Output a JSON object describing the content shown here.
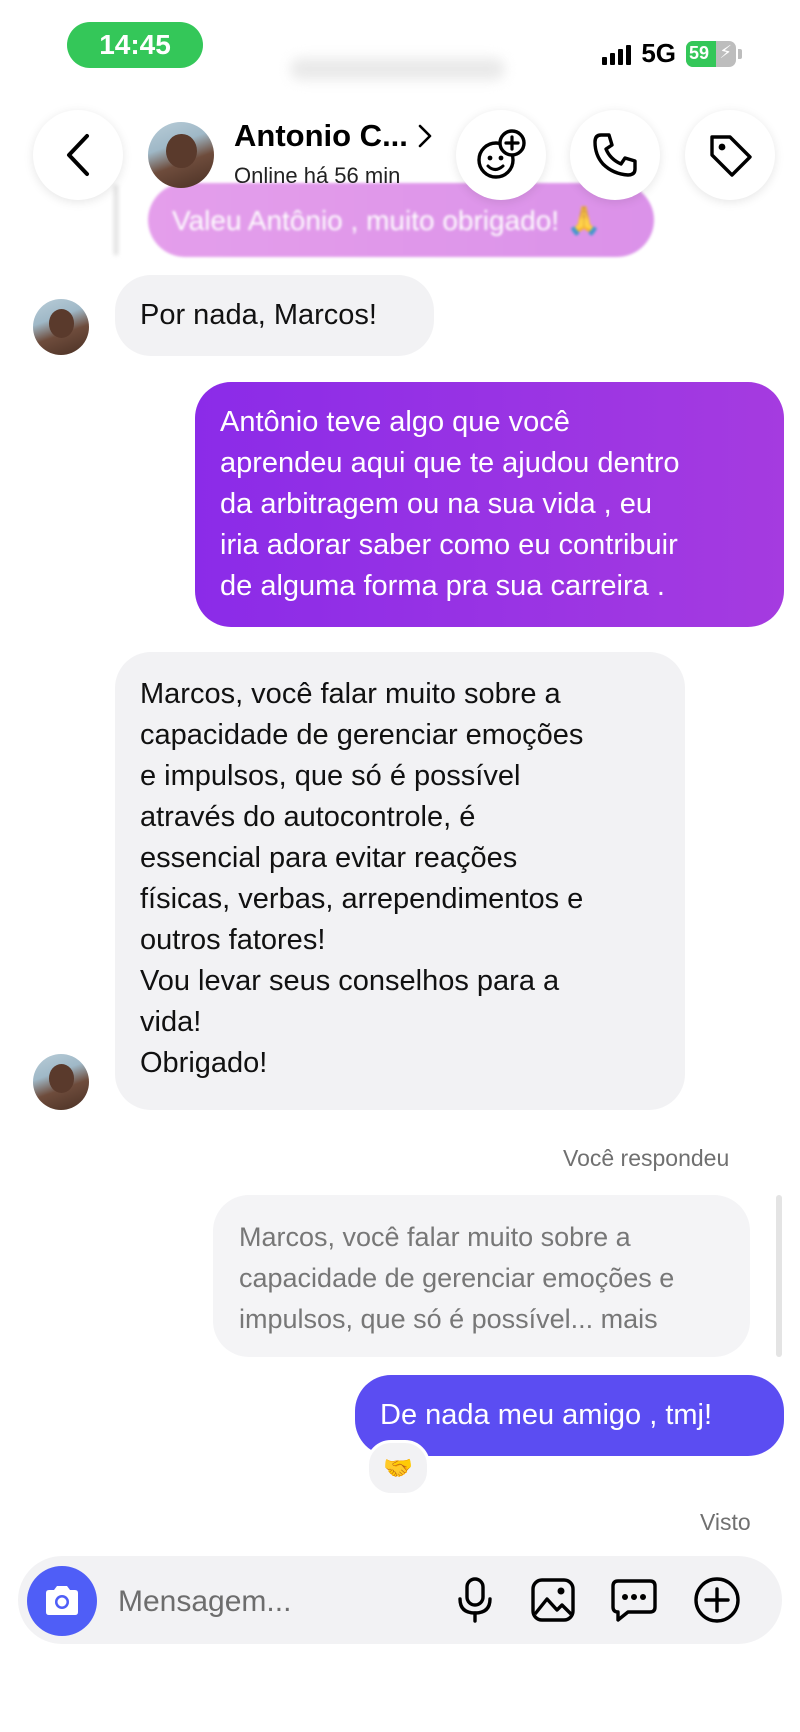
{
  "status_bar": {
    "time": "14:45",
    "network": "5G",
    "battery": "59",
    "battery_level": 0.59
  },
  "header": {
    "contact_name": "Antonio C...",
    "presence": "Online há 56 min",
    "icons": [
      "back-chevron-icon",
      "add-effect-icon",
      "phone-icon",
      "tag-icon"
    ]
  },
  "messages": {
    "previous": "Valeu Antônio , muito obrigado! 🙏",
    "m1": "Por nada, Marcos!",
    "m2": "Antônio teve algo que você\naprendeu aqui que te ajudou dentro\nda arbitragem ou na sua vida , eu\niria adorar saber como eu contribuir\nde alguma forma pra sua carreira .",
    "m3": "Marcos, você falar muito sobre a\ncapacidade de gerenciar emoções\ne impulsos, que só é possível\natravés do autocontrole,  é\nessencial para evitar reações\nfísicas, verbas, arrependimentos e\noutros fatores!\nVou levar seus conselhos para a\nvida!\nObrigado!",
    "reply_label": "Você respondeu",
    "reply_quote": "Marcos, você falar muito sobre a\ncapacidade de gerenciar emoções e\nimpulsos, que só é possível... mais",
    "m4": "De nada meu amigo , tmj!",
    "reaction": "🤝",
    "seen": "Visto"
  },
  "composer": {
    "placeholder": "Mensagem...",
    "icons": [
      "camera-icon",
      "microphone-icon",
      "gallery-icon",
      "chat-sticker-icon",
      "plus-icon"
    ]
  },
  "colors": {
    "bubble_out_start": "#8b2be8",
    "bubble_out_end": "#a53be0",
    "bubble_out_blue": "#5b4df2",
    "bubble_in": "#f2f2f4",
    "camera_button": "#4f5ef7",
    "time_pill": "#34c759"
  }
}
